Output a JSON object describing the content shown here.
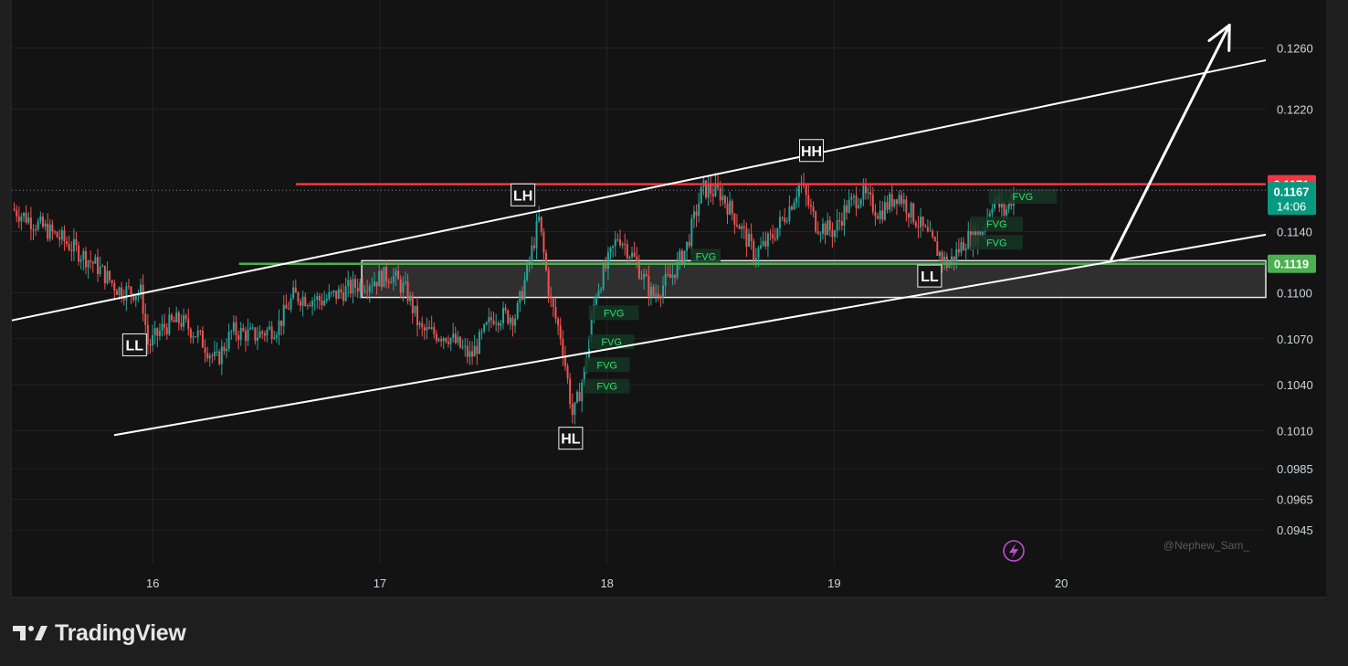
{
  "watermark": "@Nephew_Sam_",
  "brand": {
    "name": "TradingView"
  },
  "colors": {
    "background": "#131313",
    "grid": "#232323",
    "bull": "#26a69a",
    "bear": "#ef5350",
    "resistance": "#f23645",
    "support": "#4caf50",
    "channel": "#ffffff",
    "fvg_text": "#2ee06e",
    "fvg_box": "#163524",
    "zone_fill": "#3a3a3a",
    "current_price_bg": "#089981",
    "lightning": "#c04bd6"
  },
  "chart_data": {
    "type": "candlestick",
    "title": "",
    "xlabel": "",
    "ylabel": "",
    "xlim": [
      15.38,
      20.9
    ],
    "ylim": [
      0.0923,
      0.1283
    ],
    "x_ticks": [
      {
        "value": 16,
        "label": "16"
      },
      {
        "value": 17,
        "label": "17"
      },
      {
        "value": 18,
        "label": "18"
      },
      {
        "value": 19,
        "label": "19"
      },
      {
        "value": 20,
        "label": "20"
      }
    ],
    "y_ticks": [
      {
        "value": 0.126,
        "label": "0.1260"
      },
      {
        "value": 0.122,
        "label": "0.1220"
      },
      {
        "value": 0.114,
        "label": "0.1140"
      },
      {
        "value": 0.11,
        "label": "0.1100"
      },
      {
        "value": 0.107,
        "label": "0.1070"
      },
      {
        "value": 0.104,
        "label": "0.1040"
      },
      {
        "value": 0.101,
        "label": "0.1010"
      },
      {
        "value": 0.0985,
        "label": "0.0985"
      },
      {
        "value": 0.0965,
        "label": "0.0965"
      },
      {
        "value": 0.0945,
        "label": "0.0945"
      }
    ],
    "price_path": [
      [
        15.38,
        0.1155
      ],
      [
        15.6,
        0.1135
      ],
      [
        15.75,
        0.1118
      ],
      [
        15.85,
        0.1102
      ],
      [
        15.95,
        0.11
      ],
      [
        15.98,
        0.1065
      ],
      [
        16.05,
        0.1078
      ],
      [
        16.12,
        0.1082
      ],
      [
        16.2,
        0.1072
      ],
      [
        16.28,
        0.1055
      ],
      [
        16.35,
        0.1075
      ],
      [
        16.45,
        0.1072
      ],
      [
        16.55,
        0.1078
      ],
      [
        16.62,
        0.1098
      ],
      [
        16.75,
        0.1095
      ],
      [
        16.9,
        0.1105
      ],
      [
        17.05,
        0.1112
      ],
      [
        17.12,
        0.11
      ],
      [
        17.18,
        0.1075
      ],
      [
        17.3,
        0.1072
      ],
      [
        17.4,
        0.1058
      ],
      [
        17.5,
        0.1085
      ],
      [
        17.6,
        0.1085
      ],
      [
        17.65,
        0.1115
      ],
      [
        17.7,
        0.1148
      ],
      [
        17.75,
        0.1095
      ],
      [
        17.8,
        0.107
      ],
      [
        17.85,
        0.1018
      ],
      [
        17.9,
        0.1048
      ],
      [
        17.95,
        0.11
      ],
      [
        18.0,
        0.1118
      ],
      [
        18.05,
        0.1138
      ],
      [
        18.12,
        0.1122
      ],
      [
        18.2,
        0.1098
      ],
      [
        18.28,
        0.111
      ],
      [
        18.35,
        0.113
      ],
      [
        18.42,
        0.1168
      ],
      [
        18.5,
        0.1165
      ],
      [
        18.58,
        0.1145
      ],
      [
        18.65,
        0.1125
      ],
      [
        18.72,
        0.1135
      ],
      [
        18.8,
        0.1155
      ],
      [
        18.85,
        0.1172
      ],
      [
        18.92,
        0.1145
      ],
      [
        19.0,
        0.114
      ],
      [
        19.05,
        0.1155
      ],
      [
        19.12,
        0.1165
      ],
      [
        19.2,
        0.1152
      ],
      [
        19.28,
        0.1165
      ],
      [
        19.35,
        0.115
      ],
      [
        19.42,
        0.1135
      ],
      [
        19.5,
        0.1118
      ],
      [
        19.58,
        0.1135
      ],
      [
        19.65,
        0.114
      ],
      [
        19.7,
        0.1162
      ],
      [
        19.75,
        0.1152
      ],
      [
        19.8,
        0.1168
      ]
    ],
    "horizontal_levels": [
      {
        "price": 0.1171,
        "label": "0.1171",
        "role": "resistance",
        "x_start": 16.63
      },
      {
        "price": 0.1119,
        "label": "0.1119",
        "role": "support",
        "x_start": 16.38
      }
    ],
    "current_price": {
      "price": 0.1167,
      "label": "0.1167",
      "countdown": "14:06"
    },
    "zone": {
      "x_start": 16.92,
      "price_top": 0.1121,
      "price_bottom": 0.1097
    },
    "channel_lines": [
      {
        "x1": 15.38,
        "y1": 0.1082,
        "x2": 20.9,
        "y2": 0.1252
      },
      {
        "x1": 15.83,
        "y1": 0.1007,
        "x2": 20.9,
        "y2": 0.1138
      }
    ],
    "projection_arrow": {
      "x1": 20.22,
      "y1": 0.1122,
      "x2": 20.74,
      "y2": 0.1275
    },
    "swing_labels": [
      {
        "label": "LL",
        "x": 15.92,
        "price": 0.1066
      },
      {
        "label": "LH",
        "x": 17.63,
        "price": 0.1164
      },
      {
        "label": "HL",
        "x": 17.84,
        "price": 0.1005
      },
      {
        "label": "HH",
        "x": 18.9,
        "price": 0.1193
      },
      {
        "label": "LL",
        "x": 19.42,
        "price": 0.1111
      }
    ],
    "fvg_zones": [
      {
        "label": "FVG",
        "x1": 19.68,
        "x2": 19.98,
        "price": 0.1163
      },
      {
        "label": "FVG",
        "x1": 19.6,
        "x2": 19.83,
        "price": 0.1145
      },
      {
        "label": "FVG",
        "x1": 19.6,
        "x2": 19.83,
        "price": 0.1133
      },
      {
        "label": "FVG",
        "x1": 18.37,
        "x2": 18.5,
        "price": 0.1124
      },
      {
        "label": "FVG",
        "x1": 17.92,
        "x2": 18.14,
        "price": 0.1087
      },
      {
        "label": "FVG",
        "x1": 17.92,
        "x2": 18.12,
        "price": 0.1068
      },
      {
        "label": "FVG",
        "x1": 17.9,
        "x2": 18.1,
        "price": 0.1053
      },
      {
        "label": "FVG",
        "x1": 17.9,
        "x2": 18.1,
        "price": 0.1039
      }
    ]
  }
}
